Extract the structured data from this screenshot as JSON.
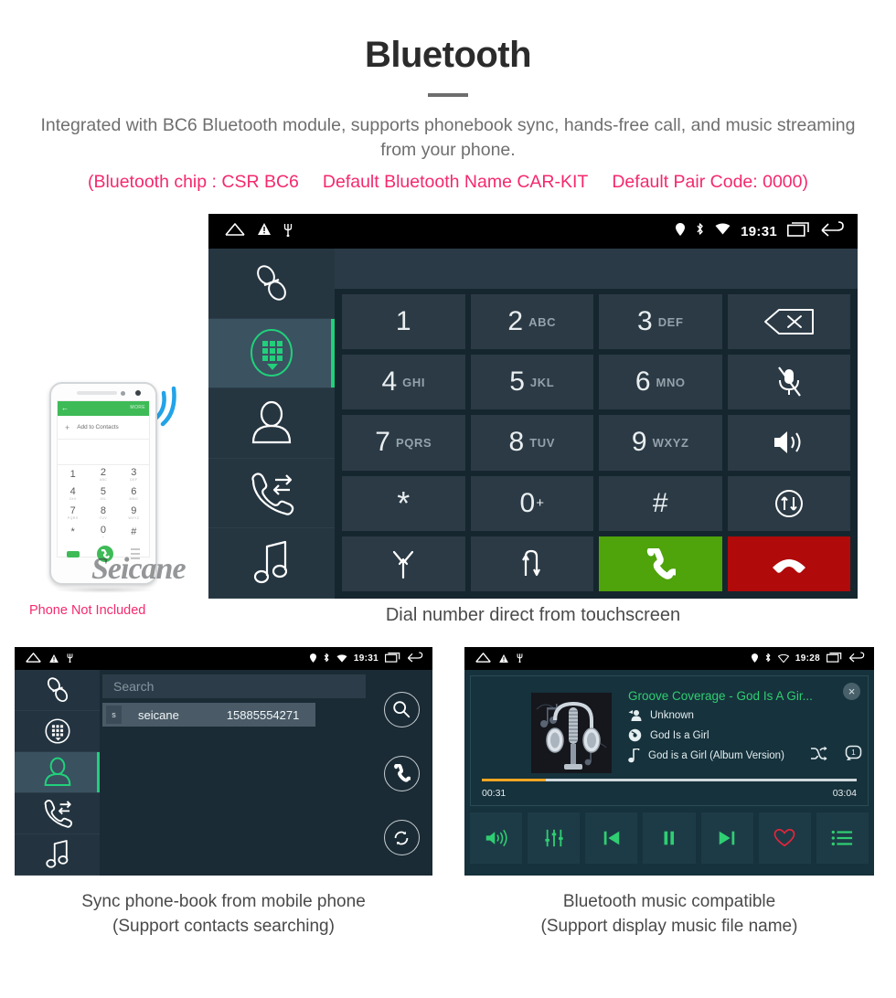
{
  "header": {
    "title": "Bluetooth",
    "subtitle": "Integrated with BC6 Bluetooth module, supports phonebook sync, hands-free call, and music streaming from your phone.",
    "spec_open": "(Bluetooth chip : CSR BC6",
    "spec_mid": "Default Bluetooth Name CAR-KIT",
    "spec_end": "Default Pair Code: 0000)",
    "accent_color": "#f4296d",
    "title_color": "#2b2b2b",
    "subtitle_color": "#6f6f6f"
  },
  "main_screen": {
    "status_bar": {
      "time": "19:31",
      "left_icons": [
        "home-icon",
        "warning-icon",
        "usb-icon"
      ],
      "right_icons": [
        "location-icon",
        "bluetooth-icon",
        "wifi-icon",
        "recents-icon",
        "back-icon"
      ]
    },
    "sidebar": [
      {
        "name": "link",
        "label": "bluetooth-link",
        "active": false
      },
      {
        "name": "dialpad",
        "label": "dial-pad",
        "active": true
      },
      {
        "name": "contacts",
        "label": "contacts",
        "active": false
      },
      {
        "name": "call-log",
        "label": "call-log",
        "active": false
      },
      {
        "name": "music",
        "label": "bluetooth-music",
        "active": false
      }
    ],
    "keypad": [
      {
        "digit": "1",
        "letters": ""
      },
      {
        "digit": "2",
        "letters": "ABC"
      },
      {
        "digit": "3",
        "letters": "DEF"
      },
      {
        "icon": "backspace-icon"
      },
      {
        "digit": "4",
        "letters": "GHI"
      },
      {
        "digit": "5",
        "letters": "JKL"
      },
      {
        "digit": "6",
        "letters": "MNO"
      },
      {
        "icon": "mic-mute-icon"
      },
      {
        "digit": "7",
        "letters": "PQRS"
      },
      {
        "digit": "8",
        "letters": "TUV"
      },
      {
        "digit": "9",
        "letters": "WXYZ"
      },
      {
        "icon": "speaker-icon"
      },
      {
        "digit": "*",
        "letters": ""
      },
      {
        "digit": "0",
        "letters": "",
        "sup": "+"
      },
      {
        "digit": "#",
        "letters": ""
      },
      {
        "icon": "transfer-icon"
      },
      {
        "icon": "merge-call-icon"
      },
      {
        "icon": "swap-call-icon"
      },
      {
        "icon": "call-answer-icon",
        "style": "green"
      },
      {
        "icon": "call-end-icon",
        "style": "red"
      }
    ],
    "colors": {
      "screen_bg": "#14242e",
      "sidebar_bg": "#253641",
      "key_bg": "#2b3a45",
      "accent_green": "#21d07a",
      "call_green": "#4fa30b",
      "end_red": "#b00a0a"
    },
    "caption": "Dial number direct from touchscreen"
  },
  "phone": {
    "note": "Phone Not Included",
    "watermark": "Seicane",
    "screen": {
      "more_label": "MORE",
      "add_contact": "Add to Contacts",
      "keys": [
        {
          "n": "1",
          "s": ""
        },
        {
          "n": "2",
          "s": "ABC"
        },
        {
          "n": "3",
          "s": "DEF"
        },
        {
          "n": "4",
          "s": "GHI"
        },
        {
          "n": "5",
          "s": "JKL"
        },
        {
          "n": "6",
          "s": "MNO"
        },
        {
          "n": "7",
          "s": "PQRS"
        },
        {
          "n": "8",
          "s": "TUV"
        },
        {
          "n": "9",
          "s": "WXYZ"
        },
        {
          "n": "*",
          "s": ""
        },
        {
          "n": "0",
          "s": "+"
        },
        {
          "n": "#",
          "s": ""
        }
      ]
    }
  },
  "contacts_screen": {
    "status_bar": {
      "time": "19:31"
    },
    "sidebar": [
      {
        "name": "link",
        "active": false
      },
      {
        "name": "dialpad",
        "active": false
      },
      {
        "name": "contacts",
        "active": true
      },
      {
        "name": "call-log",
        "active": false
      },
      {
        "name": "music",
        "active": false
      }
    ],
    "search_placeholder": "Search",
    "contact": {
      "initial": "s",
      "name": "seicane",
      "number": "15885554271"
    },
    "actions": [
      "search-icon",
      "call-icon",
      "sync-icon"
    ],
    "caption_line1": "Sync phone-book from mobile phone",
    "caption_line2": "(Support contacts searching)"
  },
  "music_screen": {
    "status_bar": {
      "time": "19:28"
    },
    "track_title": "Groove Coverage - God Is A Gir...",
    "artist": "Unknown",
    "album": "God Is a Girl",
    "file_name": "God is a Girl (Album Version)",
    "elapsed": "00:31",
    "duration": "03:04",
    "progress_percent": 17,
    "progress_color": "#f5a623",
    "title_color": "#2fce72",
    "controls": [
      "volume-icon",
      "equalizer-icon",
      "previous-icon",
      "pause-icon",
      "next-icon",
      "favorite-icon",
      "playlist-icon"
    ],
    "shuffle_icon": "shuffle-icon",
    "repeat_icon": "repeat-one-icon",
    "close_label": "×",
    "caption_line1": "Bluetooth music compatible",
    "caption_line2": "(Support display music file name)"
  }
}
